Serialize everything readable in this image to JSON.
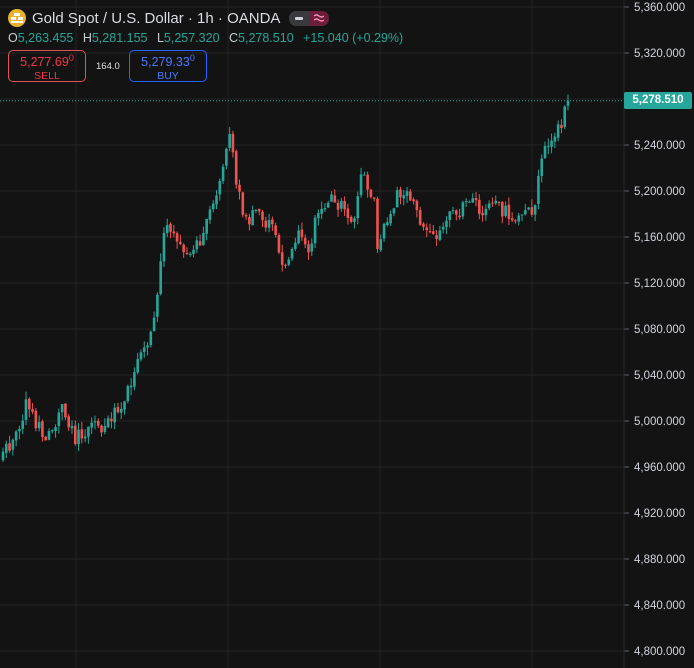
{
  "header": {
    "title": "Gold Spot / U.S. Dollar · 1h · OANDA",
    "icons": [
      "gold-logo-icon",
      "minus-icon",
      "wave-icon"
    ]
  },
  "ohlc": {
    "o_label": "O",
    "o_value": "5,263.455",
    "h_label": "H",
    "h_value": "5,281.155",
    "l_label": "L",
    "l_value": "5,257.320",
    "c_label": "C",
    "c_value": "5,278.510",
    "change": "+15.040 (+0.29%)"
  },
  "trade": {
    "sell_price": "5,277.69",
    "sell_sup": "0",
    "sell_label": "SELL",
    "spread": "164.0",
    "buy_price": "5,279.33",
    "buy_sup": "0",
    "buy_label": "BUY"
  },
  "current_price": "5,278.510",
  "colors": {
    "background": "#131313",
    "up": "#26a69a",
    "down": "#ef5350",
    "sell": "#f23645",
    "buy": "#2962ff",
    "grid": "#232323"
  },
  "chart_data": {
    "type": "candlestick",
    "title": "Gold Spot / U.S. Dollar · 1h · OANDA",
    "ylim": [
      4795,
      5362
    ],
    "y_ticks": [
      "5,360.000",
      "5,320.000",
      "5,280.000",
      "5,240.000",
      "5,200.000",
      "5,160.000",
      "5,120.000",
      "5,080.000",
      "5,040.000",
      "5,000.000",
      "4,960.000",
      "4,920.000",
      "4,880.000",
      "4,840.000",
      "4,800.000"
    ],
    "y_tick_values": [
      5360,
      5320,
      5280,
      5240,
      5200,
      5160,
      5120,
      5080,
      5040,
      5000,
      4960,
      4920,
      4880,
      4840,
      4800
    ],
    "last_price": 5278.51,
    "grid": true,
    "keypoints": [
      [
        0,
        4970
      ],
      [
        4,
        4990
      ],
      [
        7,
        5015
      ],
      [
        10,
        5000
      ],
      [
        14,
        4985
      ],
      [
        18,
        5010
      ],
      [
        22,
        4982
      ],
      [
        27,
        5000
      ],
      [
        31,
        4995
      ],
      [
        35,
        5008
      ],
      [
        38,
        5030
      ],
      [
        42,
        5055
      ],
      [
        45,
        5075
      ],
      [
        47,
        5110
      ],
      [
        49,
        5160
      ],
      [
        51,
        5170
      ],
      [
        53,
        5158
      ],
      [
        55,
        5140
      ],
      [
        58,
        5150
      ],
      [
        61,
        5160
      ],
      [
        63,
        5180
      ],
      [
        65,
        5200
      ],
      [
        67,
        5225
      ],
      [
        69,
        5245
      ],
      [
        70,
        5240
      ],
      [
        71,
        5210
      ],
      [
        73,
        5185
      ],
      [
        75,
        5175
      ],
      [
        78,
        5180
      ],
      [
        81,
        5170
      ],
      [
        83,
        5160
      ],
      [
        84,
        5150
      ],
      [
        85,
        5138
      ],
      [
        86,
        5130
      ],
      [
        88,
        5145
      ],
      [
        90,
        5160
      ],
      [
        92,
        5150
      ],
      [
        93,
        5140
      ],
      [
        95,
        5170
      ],
      [
        97,
        5185
      ],
      [
        100,
        5195
      ],
      [
        103,
        5185
      ],
      [
        106,
        5175
      ],
      [
        108,
        5190
      ],
      [
        109,
        5210
      ],
      [
        111,
        5205
      ],
      [
        113,
        5190
      ],
      [
        114,
        5155
      ],
      [
        116,
        5170
      ],
      [
        118,
        5185
      ],
      [
        120,
        5195
      ],
      [
        122,
        5200
      ],
      [
        124,
        5190
      ],
      [
        126,
        5180
      ],
      [
        128,
        5175
      ],
      [
        130,
        5165
      ],
      [
        132,
        5160
      ],
      [
        134,
        5170
      ],
      [
        136,
        5180
      ],
      [
        138,
        5175
      ],
      [
        140,
        5185
      ],
      [
        142,
        5195
      ],
      [
        144,
        5190
      ],
      [
        146,
        5180
      ],
      [
        148,
        5185
      ],
      [
        150,
        5190
      ],
      [
        152,
        5183
      ],
      [
        154,
        5180
      ],
      [
        156,
        5178
      ],
      [
        158,
        5177
      ],
      [
        160,
        5180
      ],
      [
        162,
        5190
      ],
      [
        163,
        5215
      ],
      [
        164,
        5232
      ],
      [
        166,
        5240
      ],
      [
        168,
        5245
      ],
      [
        170,
        5258
      ],
      [
        171,
        5268
      ],
      [
        172,
        5278.51
      ]
    ]
  }
}
